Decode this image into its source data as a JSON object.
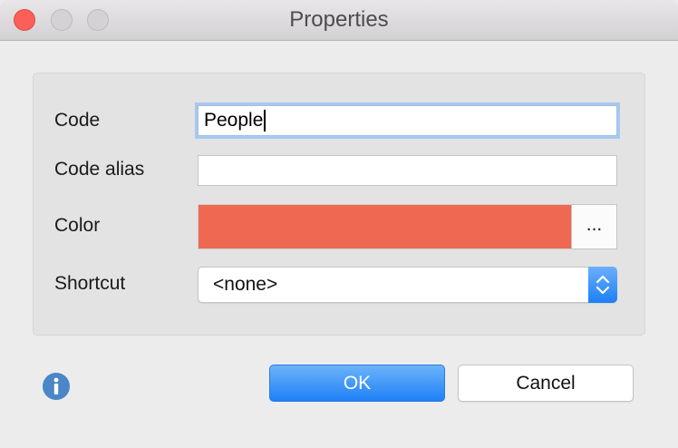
{
  "window": {
    "title": "Properties"
  },
  "form": {
    "code_label": "Code",
    "code_value": "People",
    "code_alias_label": "Code alias",
    "code_alias_value": "",
    "color_label": "Color",
    "color_value": "#ee6852",
    "color_button_label": "...",
    "shortcut_label": "Shortcut",
    "shortcut_value": "<none>"
  },
  "buttons": {
    "ok_label": "OK",
    "cancel_label": "Cancel"
  },
  "icons": {
    "info": "info-icon",
    "select_arrows": "chevron-up-down-icon"
  },
  "colors": {
    "accent": "#1e81f6",
    "info": "#4a86c8",
    "close": "#fc5f57"
  }
}
